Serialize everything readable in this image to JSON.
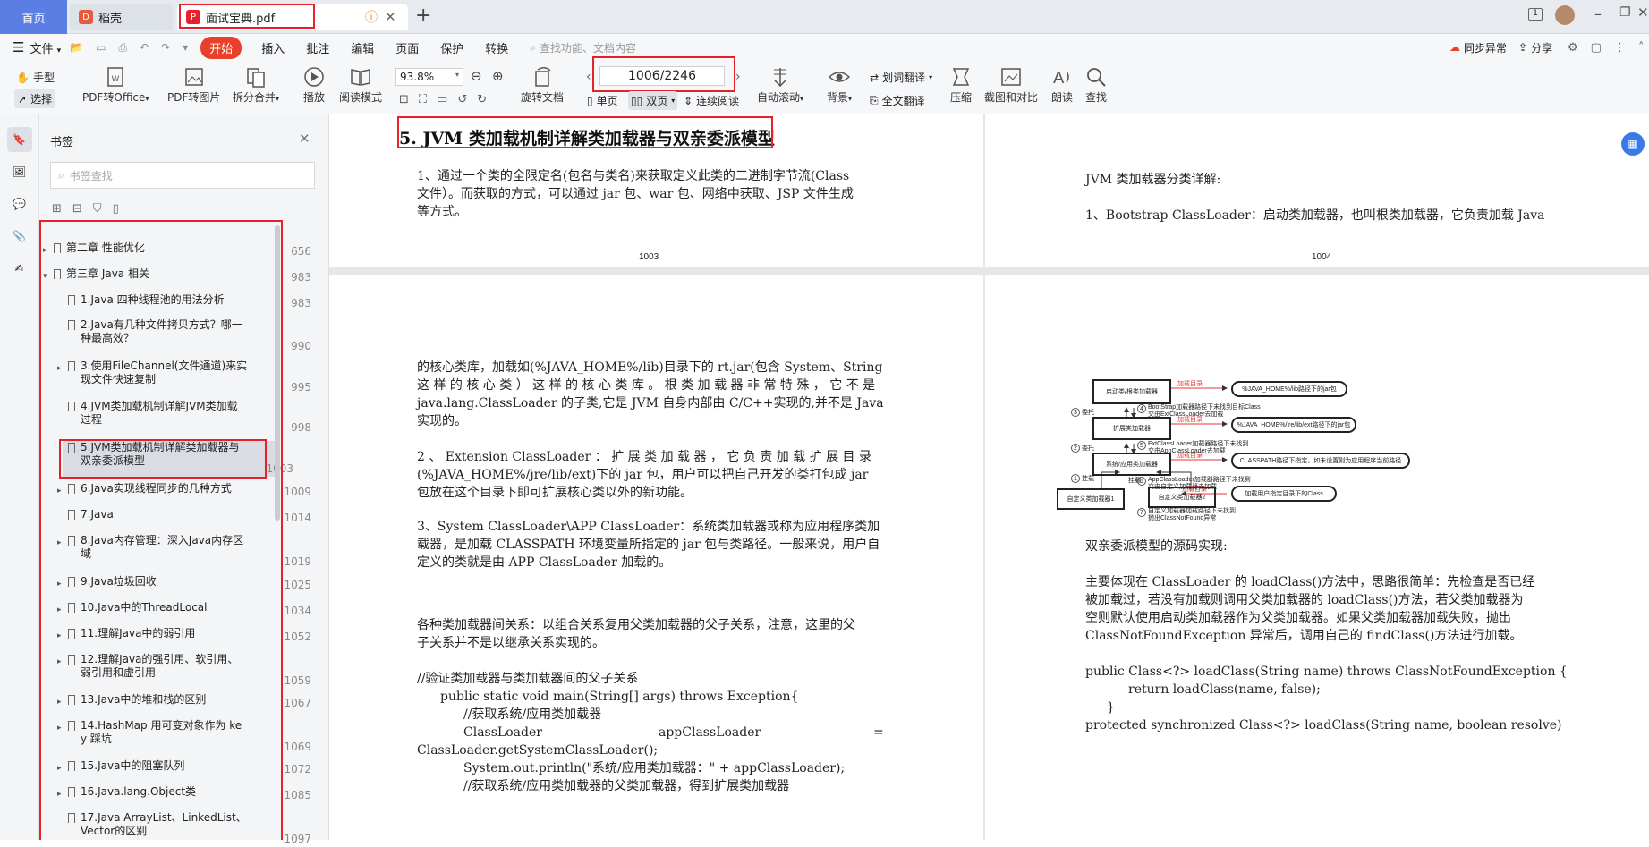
{
  "tabs": {
    "home": "首页",
    "straw": "稻壳",
    "pdf": "面试宝典.pdf"
  },
  "menu": {
    "file": "文件",
    "start": "开始",
    "items": [
      "插入",
      "批注",
      "编辑",
      "页面",
      "保护",
      "转换"
    ],
    "search_placeholder": "查找功能、文档内容",
    "sync": "同步异常",
    "share": "分享"
  },
  "toolbar": {
    "hand": "手型",
    "select": "选择",
    "pdf_to_office": "PDF转Office",
    "pdf_to_image": "PDF转图片",
    "split_merge": "拆分合并",
    "play": "播放",
    "read_mode": "阅读模式",
    "zoom": "93.8%",
    "page_input": "1006/2246",
    "rotate": "旋转文档",
    "single": "单页",
    "double": "双页",
    "continuous": "连续阅读",
    "auto_scroll": "自动滚动",
    "background": "背景",
    "word_translate": "划词翻译",
    "full_translate": "全文翻译",
    "compress": "压缩",
    "screenshot": "截图和对比",
    "read_aloud": "朗读",
    "find": "查找"
  },
  "bookmarks": {
    "header": "书签",
    "search_placeholder": "书签查找",
    "items": [
      {
        "title": "第二章 性能优化",
        "page": "656"
      },
      {
        "title": "第三章 Java 相关",
        "page": "983"
      },
      {
        "title": "1.Java 四种线程池的用法分析",
        "page": "983"
      },
      {
        "title_1": "2.Java有几种文件拷贝方式？哪一",
        "title_2": "种最高效？",
        "page": "990"
      },
      {
        "title_1": "3.使用FileChannel(文件通道)来实",
        "title_2": "现文件快速复制",
        "page": "995"
      },
      {
        "title_1": "4.JVM类加载机制详解JVM类加载",
        "title_2": "过程",
        "page": "998"
      },
      {
        "title_1": "5.JVM类加载机制详解类加载器与",
        "title_2": "双亲委派模型",
        "page": "1003"
      },
      {
        "title": "6.Java实现线程同步的几种方式",
        "page": "1009"
      },
      {
        "title": "7.Java",
        "page": "1014"
      },
      {
        "title_1": "8.Java内存管理：深入Java内存区",
        "title_2": "域",
        "page": "1019"
      },
      {
        "title": "9.Java垃圾回收",
        "page": "1025"
      },
      {
        "title": "10.Java中的ThreadLocal",
        "page": "1034"
      },
      {
        "title": "11.理解Java中的弱引用",
        "page": "1052"
      },
      {
        "title_1": "12.理解Java的强引用、软引用、",
        "title_2": "弱引用和虚引用",
        "page": "1059"
      },
      {
        "title": "13.Java中的堆和栈的区别",
        "page": "1067"
      },
      {
        "title_1": "14.HashMap 用可变对象作为 ke",
        "title_2": "y 踩坑",
        "page": "1069"
      },
      {
        "title": "15.Java中的阻塞队列",
        "page": "1072"
      },
      {
        "title": "16.Java.lang.Object类",
        "page": "1085"
      },
      {
        "title_1": "17.Java ArrayList、LinkedList、",
        "title_2": "Vector的区别",
        "page": "1097"
      }
    ]
  },
  "page1003": {
    "heading": "5. JVM 类加载机制详解类加载器与双亲委派模型",
    "p1": "1、通过一个类的全限定名(包名与类名)来获取定义此类的二进制字节流(Class",
    "p2": "文件）。而获取的方式，可以通过 jar 包、war 包、网络中获取、JSP 文件生成",
    "p3": "等方式。",
    "num": "1003"
  },
  "page1004": {
    "l1": "JVM 类加载器分类详解:",
    "l2": "1、Bootstrap ClassLoader：启动类加载器，也叫根类加载器，它负责加载 Java",
    "num": "1004"
  },
  "page1005": {
    "a1": "的核心类库，加载如(%JAVA_HOME%/lib)目录下的 rt.jar(包含 System、String",
    "a2": "这 样 的 核 心 类 ） 这 样 的 核 心 类 库 。 根 类 加 载 器 非 常 特 殊 ， 它 不 是",
    "a3": "java.lang.ClassLoader 的子类,它是 JVM 自身内部由 C/C++实现的,并不是 Java",
    "a4": "实现的。",
    "b1": "2 、 Extension ClassLoader ： 扩 展 类 加 载 器 ， 它 负 责 加 载 扩 展 目 录",
    "b2": "(%JAVA_HOME%/jre/lib/ext)下的 jar 包，用户可以把自己开发的类打包成 jar",
    "b3": "包放在这个目录下即可扩展核心类以外的新功能。",
    "c1": "3、System ClassLoader\\APP ClassLoader：系统类加载器或称为应用程序类加",
    "c2": "载器，是加载 CLASSPATH 环境变量所指定的 jar 包与类路径。一般来说，用户自",
    "c3": "定义的类就是由 APP ClassLoader 加载的。",
    "d1": "各种类加载器间关系：以组合关系复用父类加载器的父子关系，注意，这里的父",
    "d2": "子关系并不是以继承关系实现的。",
    "e1": "//验证类加载器与类加载器间的父子关系",
    "e2": "public static void main(String[] args) throws Exception{",
    "e3": "//获取系统/应用类加载器",
    "e4": "ClassLoader",
    "e4b": "appClassLoader",
    "e4c": "=",
    "e5": "ClassLoader.getSystemClassLoader();",
    "e6": "System.out.println(\"系统/应用类加载器：\" + appClassLoader);",
    "e7": "//获取系统/应用类加载器的父类加载器，得到扩展类加载器"
  },
  "diagram": {
    "boot": "启动类/根类加载器",
    "ext": "扩展类加载器",
    "app": "系统/应用类加载器",
    "custom1": "自定义类加载器1",
    "custom2": "自定义类加载器2",
    "load_dir": "加载目录",
    "path1": "%JAVA_HOME%/lib路径下的jar包",
    "path2": "%JAVA_HOME%/jre/lib/ext路径下的jar包",
    "path3": "CLASSPATH路径下指定，如未设置则为应用程序当前路径",
    "path4": "加载用户指定目录下的Class",
    "n1": "1",
    "n2": "2",
    "n3": "3",
    "n4": "4",
    "n5": "5",
    "n6": "6",
    "n7": "7",
    "delegate": "委托",
    "mount": "挂载",
    "t4a": "BootStrap加载器路径下未找到目标Class",
    "t4b": "交由ExtClassLoader去加载",
    "t5a": "ExtClassLoader加载器路径下未找到",
    "t5b": "交由AppClassLoader去加载",
    "t6a": "AppClassLoader加载器路径下未找到",
    "t6b": "交由自定义加载器去加载",
    "t7a": "自定义加载器加载路径下未找到",
    "t7b": "抛出ClassNotFound异常"
  },
  "page1006": {
    "h": "双亲委派模型的源码实现:",
    "p1": "主要体现在 ClassLoader 的 loadClass()方法中，思路很简单：先检查是否已经",
    "p2": "被加载过，若没有加载则调用父类加载器的 loadClass()方法，若父类加载器为",
    "p3": "空则默认使用启动类加载器作为父类加载器。如果父类加载器加载失败，抛出",
    "p4": "ClassNotFoundException 异常后，调用自己的 findClass()方法进行加载。",
    "c1": "public Class<?> loadClass(String name) throws ClassNotFoundException {",
    "c2": "return loadClass(name, false);",
    "c3": "}",
    "c4": "protected synchronized Class<?> loadClass(String name, boolean resolve)"
  }
}
